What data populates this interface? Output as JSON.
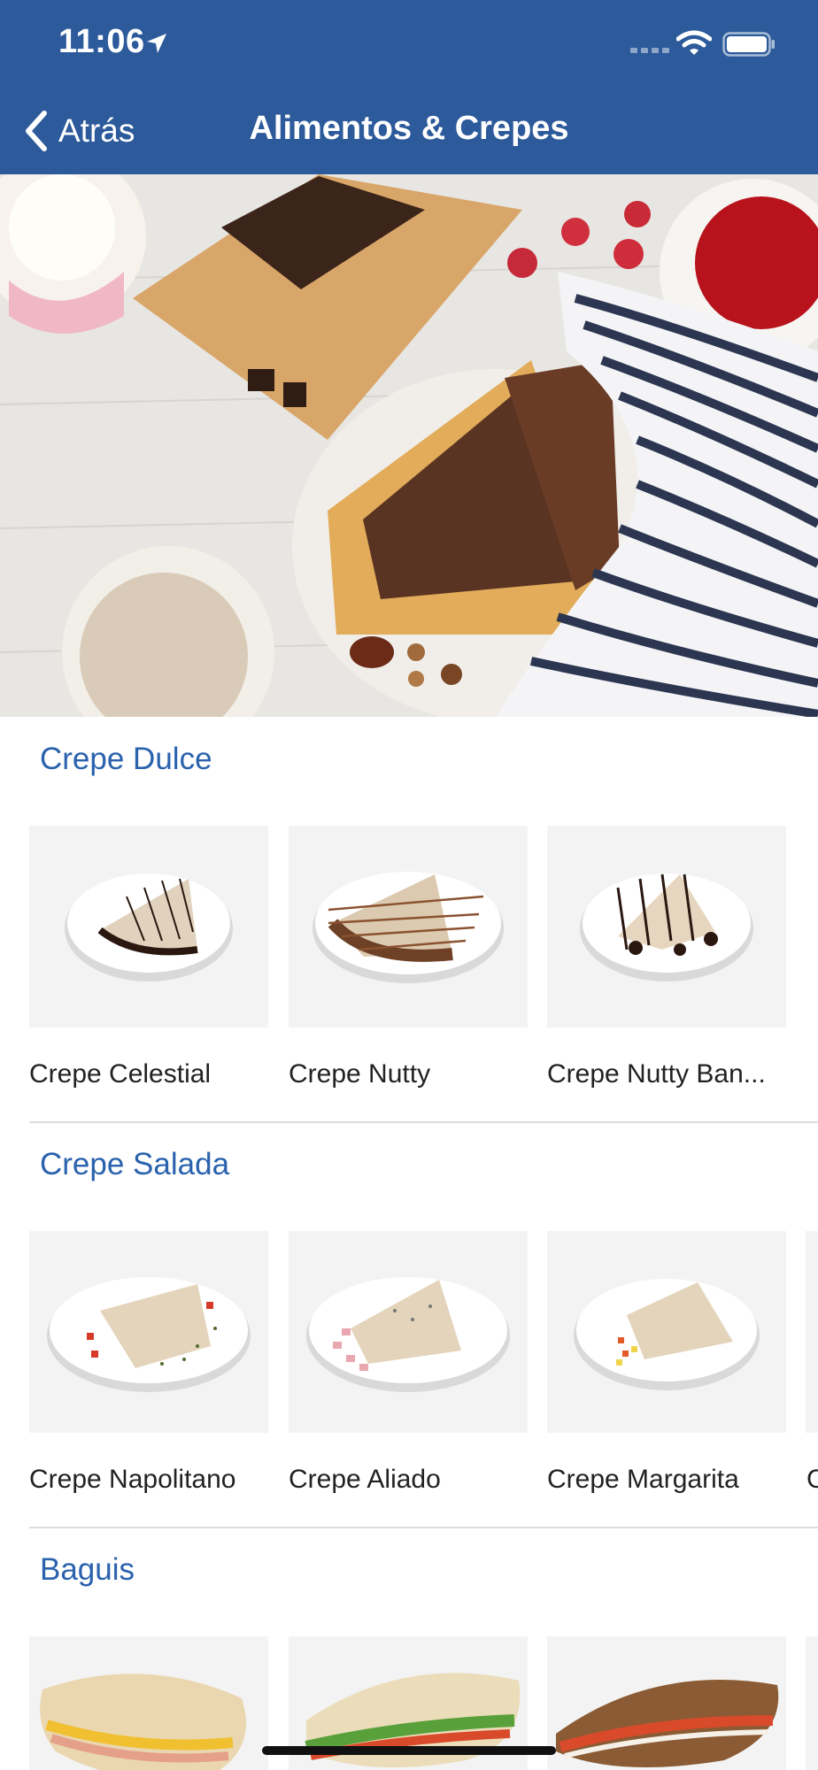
{
  "status_bar": {
    "time": "11:06"
  },
  "nav": {
    "back_label": "Atrás",
    "title": "Alimentos & Crepes"
  },
  "colors": {
    "header": "#2c5a9b",
    "section_title": "#2a62ad"
  },
  "sections": [
    {
      "title": "Crepe Dulce",
      "items": [
        "Crepe Celestial",
        "Crepe Nutty",
        "Crepe Nutty Ban..."
      ]
    },
    {
      "title": "Crepe Salada",
      "items": [
        "Crepe Napolitano",
        "Crepe Aliado",
        "Crepe Margarita"
      ],
      "peek_label": "C"
    },
    {
      "title": "Baguis",
      "items": []
    }
  ],
  "icons": [
    "location-arrow-icon",
    "signal-icon",
    "wifi-icon",
    "battery-icon",
    "chevron-left-icon"
  ]
}
